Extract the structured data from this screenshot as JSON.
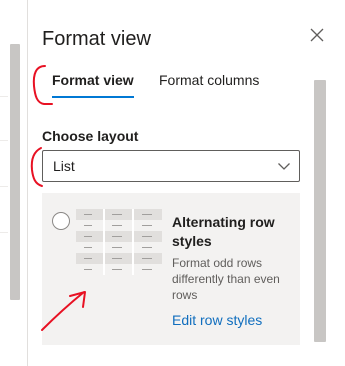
{
  "panel": {
    "title": "Format view",
    "close_icon": "close-icon"
  },
  "tabs": [
    {
      "label": "Format view",
      "selected": true
    },
    {
      "label": "Format columns",
      "selected": false
    }
  ],
  "layout": {
    "label": "Choose layout",
    "selected_value": "List",
    "chevron_icon": "chevron-down-icon"
  },
  "option_card": {
    "title": "Alternating row styles",
    "description": "Format odd rows differently than even rows",
    "link": "Edit row styles",
    "selected": false
  },
  "colors": {
    "accent": "#0078d4",
    "link": "#106ebe",
    "card_background": "#f3f2f1",
    "annotation": "#e81123"
  }
}
